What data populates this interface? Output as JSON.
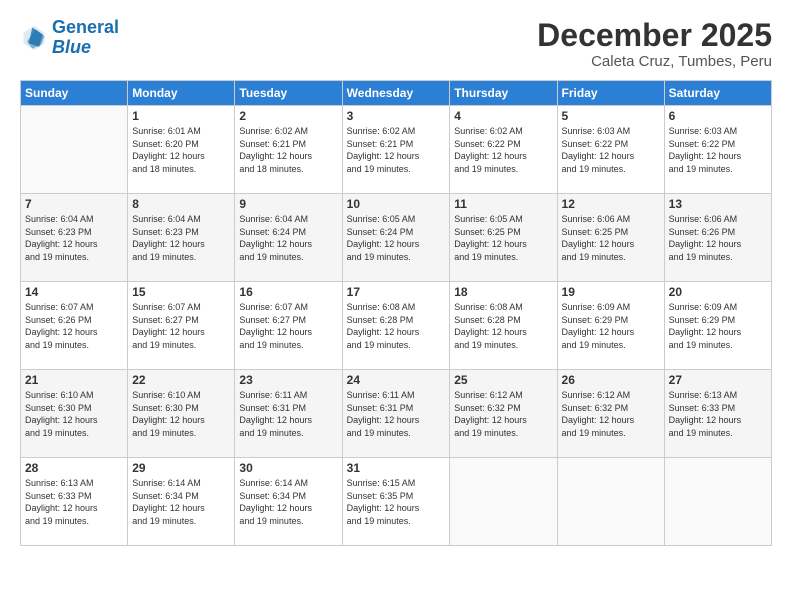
{
  "header": {
    "logo_line1": "General",
    "logo_line2": "Blue",
    "month": "December 2025",
    "location": "Caleta Cruz, Tumbes, Peru"
  },
  "days_of_week": [
    "Sunday",
    "Monday",
    "Tuesday",
    "Wednesday",
    "Thursday",
    "Friday",
    "Saturday"
  ],
  "weeks": [
    [
      {
        "day": "",
        "info": ""
      },
      {
        "day": "1",
        "info": "Sunrise: 6:01 AM\nSunset: 6:20 PM\nDaylight: 12 hours\nand 18 minutes."
      },
      {
        "day": "2",
        "info": "Sunrise: 6:02 AM\nSunset: 6:21 PM\nDaylight: 12 hours\nand 18 minutes."
      },
      {
        "day": "3",
        "info": "Sunrise: 6:02 AM\nSunset: 6:21 PM\nDaylight: 12 hours\nand 19 minutes."
      },
      {
        "day": "4",
        "info": "Sunrise: 6:02 AM\nSunset: 6:22 PM\nDaylight: 12 hours\nand 19 minutes."
      },
      {
        "day": "5",
        "info": "Sunrise: 6:03 AM\nSunset: 6:22 PM\nDaylight: 12 hours\nand 19 minutes."
      },
      {
        "day": "6",
        "info": "Sunrise: 6:03 AM\nSunset: 6:22 PM\nDaylight: 12 hours\nand 19 minutes."
      }
    ],
    [
      {
        "day": "7",
        "info": "Sunrise: 6:04 AM\nSunset: 6:23 PM\nDaylight: 12 hours\nand 19 minutes."
      },
      {
        "day": "8",
        "info": "Sunrise: 6:04 AM\nSunset: 6:23 PM\nDaylight: 12 hours\nand 19 minutes."
      },
      {
        "day": "9",
        "info": "Sunrise: 6:04 AM\nSunset: 6:24 PM\nDaylight: 12 hours\nand 19 minutes."
      },
      {
        "day": "10",
        "info": "Sunrise: 6:05 AM\nSunset: 6:24 PM\nDaylight: 12 hours\nand 19 minutes."
      },
      {
        "day": "11",
        "info": "Sunrise: 6:05 AM\nSunset: 6:25 PM\nDaylight: 12 hours\nand 19 minutes."
      },
      {
        "day": "12",
        "info": "Sunrise: 6:06 AM\nSunset: 6:25 PM\nDaylight: 12 hours\nand 19 minutes."
      },
      {
        "day": "13",
        "info": "Sunrise: 6:06 AM\nSunset: 6:26 PM\nDaylight: 12 hours\nand 19 minutes."
      }
    ],
    [
      {
        "day": "14",
        "info": "Sunrise: 6:07 AM\nSunset: 6:26 PM\nDaylight: 12 hours\nand 19 minutes."
      },
      {
        "day": "15",
        "info": "Sunrise: 6:07 AM\nSunset: 6:27 PM\nDaylight: 12 hours\nand 19 minutes."
      },
      {
        "day": "16",
        "info": "Sunrise: 6:07 AM\nSunset: 6:27 PM\nDaylight: 12 hours\nand 19 minutes."
      },
      {
        "day": "17",
        "info": "Sunrise: 6:08 AM\nSunset: 6:28 PM\nDaylight: 12 hours\nand 19 minutes."
      },
      {
        "day": "18",
        "info": "Sunrise: 6:08 AM\nSunset: 6:28 PM\nDaylight: 12 hours\nand 19 minutes."
      },
      {
        "day": "19",
        "info": "Sunrise: 6:09 AM\nSunset: 6:29 PM\nDaylight: 12 hours\nand 19 minutes."
      },
      {
        "day": "20",
        "info": "Sunrise: 6:09 AM\nSunset: 6:29 PM\nDaylight: 12 hours\nand 19 minutes."
      }
    ],
    [
      {
        "day": "21",
        "info": "Sunrise: 6:10 AM\nSunset: 6:30 PM\nDaylight: 12 hours\nand 19 minutes."
      },
      {
        "day": "22",
        "info": "Sunrise: 6:10 AM\nSunset: 6:30 PM\nDaylight: 12 hours\nand 19 minutes."
      },
      {
        "day": "23",
        "info": "Sunrise: 6:11 AM\nSunset: 6:31 PM\nDaylight: 12 hours\nand 19 minutes."
      },
      {
        "day": "24",
        "info": "Sunrise: 6:11 AM\nSunset: 6:31 PM\nDaylight: 12 hours\nand 19 minutes."
      },
      {
        "day": "25",
        "info": "Sunrise: 6:12 AM\nSunset: 6:32 PM\nDaylight: 12 hours\nand 19 minutes."
      },
      {
        "day": "26",
        "info": "Sunrise: 6:12 AM\nSunset: 6:32 PM\nDaylight: 12 hours\nand 19 minutes."
      },
      {
        "day": "27",
        "info": "Sunrise: 6:13 AM\nSunset: 6:33 PM\nDaylight: 12 hours\nand 19 minutes."
      }
    ],
    [
      {
        "day": "28",
        "info": "Sunrise: 6:13 AM\nSunset: 6:33 PM\nDaylight: 12 hours\nand 19 minutes."
      },
      {
        "day": "29",
        "info": "Sunrise: 6:14 AM\nSunset: 6:34 PM\nDaylight: 12 hours\nand 19 minutes."
      },
      {
        "day": "30",
        "info": "Sunrise: 6:14 AM\nSunset: 6:34 PM\nDaylight: 12 hours\nand 19 minutes."
      },
      {
        "day": "31",
        "info": "Sunrise: 6:15 AM\nSunset: 6:35 PM\nDaylight: 12 hours\nand 19 minutes."
      },
      {
        "day": "",
        "info": ""
      },
      {
        "day": "",
        "info": ""
      },
      {
        "day": "",
        "info": ""
      }
    ]
  ]
}
